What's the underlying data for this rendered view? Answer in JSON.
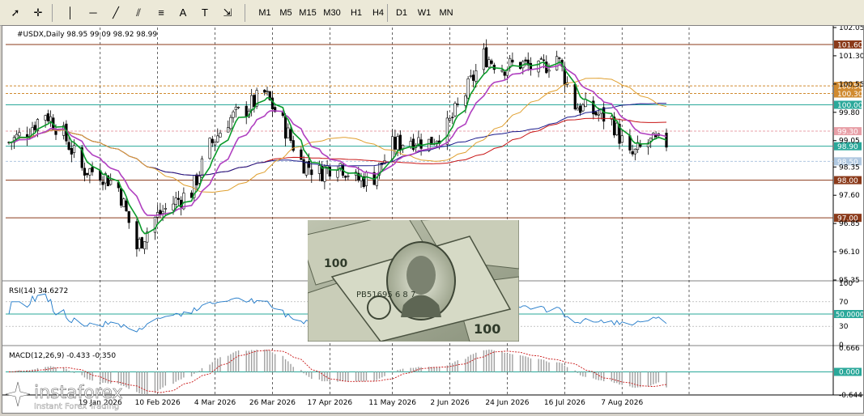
{
  "toolbar": {
    "timeframes": [
      "M1",
      "M5",
      "M15",
      "M30",
      "H1",
      "H4",
      "D1",
      "W1",
      "MN"
    ],
    "tools": [
      "cursor-icon",
      "crosshair-icon",
      "vertical-line-icon",
      "horizontal-line-icon",
      "trendline-icon",
      "equidistant-channel-icon",
      "fibonacci-icon",
      "text-icon",
      "text-label-icon",
      "arrows-icon"
    ]
  },
  "colors": {
    "candle": "#000000",
    "ma_green": "#0a9a2a",
    "ma_violet": "#b040c0",
    "ma_orange": "#e0a030",
    "ma_navy": "#1a1a8c",
    "ma_red": "#c81414",
    "rsi_line": "#1e78c8",
    "macd_hist": "#a0a0a0",
    "macd_signal": "#c81414",
    "hline_brown": "#8b3a1a",
    "hline_teal": "#2aa89a",
    "hline_orange": "#d08a30"
  },
  "main": {
    "symbol_label": "#USDX,Daily  98.95 99.09 98.92 98.99",
    "price_axis": [
      "102.05",
      "101.30",
      "100.55",
      "99.80",
      "99.05",
      "98.35",
      "97.60",
      "96.85",
      "96.10",
      "95.35"
    ],
    "levels": [
      {
        "label": "101.60",
        "value": 101.6,
        "color": "#8b3a1a"
      },
      {
        "label": "100.50",
        "value": 100.5,
        "color": "#d08a30"
      },
      {
        "label": "100.30",
        "value": 100.3,
        "color": "#d08a30"
      },
      {
        "label": "100.00",
        "value": 100.0,
        "color": "#2aa89a"
      },
      {
        "label": "99.30",
        "value": 99.3,
        "color": "#e8a0a8"
      },
      {
        "label": "98.90",
        "value": 98.9,
        "color": "#2aa89a"
      },
      {
        "label": "98.50",
        "value": 98.5,
        "color": "#b0c8e0"
      },
      {
        "label": "98.00",
        "value": 98.0,
        "color": "#8b3a1a"
      },
      {
        "label": "97.00",
        "value": 97.0,
        "color": "#8b3a1a"
      }
    ]
  },
  "rsi": {
    "label": "RSI(14) 34.6272",
    "axis": [
      "100",
      "70",
      "50",
      "30",
      "0"
    ],
    "level_label": "50.0000"
  },
  "macd": {
    "label": "MACD(12,26,9) -0.433 -0.350",
    "axis": [
      "0.666",
      "0.000",
      "-0.644"
    ]
  },
  "date_axis": [
    "19 Jan 2026",
    "10 Feb 2026",
    "4 Mar 2026",
    "26 Mar 2026",
    "17 Apr 2026",
    "11 May 2026",
    "2 Jun 2026",
    "24 Jun 2026",
    "16 Jul 2026",
    "7 Aug 2026"
  ],
  "watermark": {
    "brand": "instaforex",
    "tagline": "Instant Forex Trading"
  },
  "chart_data": {
    "type": "candlestick",
    "symbol": "#USDX",
    "timeframe": "Daily",
    "last_ohlc": {
      "open": 98.95,
      "high": 99.09,
      "low": 98.92,
      "close": 98.99
    },
    "ylim": [
      95.35,
      102.05
    ],
    "x_start": "2025-12-15",
    "x_end": "2026-08-24",
    "close_series": [
      [
        "2025-12-15",
        99.0
      ],
      [
        "2025-12-22",
        99.3
      ],
      [
        "2025-12-29",
        99.8
      ],
      [
        "2026-01-05",
        99.2
      ],
      [
        "2026-01-12",
        98.3
      ],
      [
        "2026-01-19",
        98.2
      ],
      [
        "2026-01-26",
        97.8
      ],
      [
        "2026-02-02",
        96.2
      ],
      [
        "2026-02-09",
        97.0
      ],
      [
        "2026-02-16",
        97.4
      ],
      [
        "2026-02-23",
        97.7
      ],
      [
        "2026-03-02",
        98.9
      ],
      [
        "2026-03-09",
        99.6
      ],
      [
        "2026-03-16",
        99.9
      ],
      [
        "2026-03-23",
        100.3
      ],
      [
        "2026-03-30",
        99.5
      ],
      [
        "2026-04-06",
        98.5
      ],
      [
        "2026-04-13",
        98.2
      ],
      [
        "2026-04-20",
        98.5
      ],
      [
        "2026-04-27",
        98.0
      ],
      [
        "2026-05-04",
        98.1
      ],
      [
        "2026-05-11",
        98.9
      ],
      [
        "2026-05-18",
        99.1
      ],
      [
        "2026-05-25",
        99.0
      ],
      [
        "2026-06-01",
        99.4
      ],
      [
        "2026-06-08",
        100.3
      ],
      [
        "2026-06-15",
        101.3
      ],
      [
        "2026-06-22",
        101.0
      ],
      [
        "2026-06-29",
        101.1
      ],
      [
        "2026-07-06",
        100.9
      ],
      [
        "2026-07-13",
        101.3
      ],
      [
        "2026-07-20",
        100.0
      ],
      [
        "2026-07-27",
        99.8
      ],
      [
        "2026-08-03",
        99.6
      ],
      [
        "2026-08-10",
        98.6
      ],
      [
        "2026-08-17",
        98.99
      ]
    ],
    "rsi_last": 34.6272,
    "macd": {
      "main": -0.433,
      "signal": -0.35
    }
  }
}
